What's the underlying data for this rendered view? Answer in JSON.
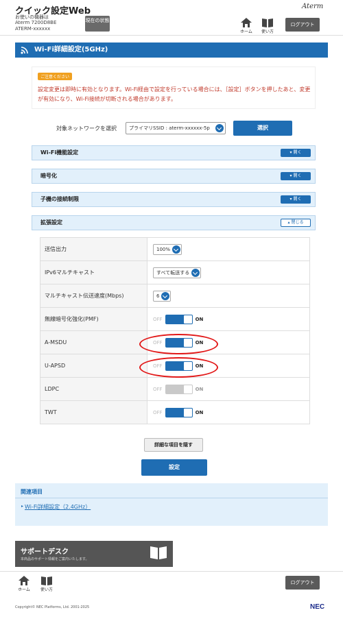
{
  "header": {
    "app_title": "クイック設定Web",
    "device_label": "お使いの機器は",
    "device_model": "Aterm 7200D8BE",
    "device_ssid": "ATERM-xxxxxx",
    "status_button": "現在の状態",
    "home_label": "ホーム",
    "help_label": "使い方",
    "logout_label": "ログアウト",
    "brand": "Aterm"
  },
  "page": {
    "title": "Wi-Fi詳細設定(5GHz)"
  },
  "caution": {
    "badge": "ご注意ください",
    "text": "設定変更は即時に有効となります。Wi-Fi経由で設定を行っている場合には、［設定］ボタンを押したあと、変更が有効になり、Wi-Fi接続が切断される場合があります。"
  },
  "network_select": {
    "label": "対象ネットワークを選択",
    "value": "プライマリSSID : aterm-xxxxxx-5p",
    "button": "選択"
  },
  "sections": [
    {
      "title": "Wi-Fi機能設定",
      "button": "開く"
    },
    {
      "title": "暗号化",
      "button": "開く"
    },
    {
      "title": "子機の接続制限",
      "button": "開く"
    },
    {
      "title": "拡張設定",
      "button": "閉じる"
    }
  ],
  "settings": [
    {
      "label": "送信出力",
      "type": "dropdown",
      "value": "100%"
    },
    {
      "label": "IPv6マルチキャスト",
      "type": "dropdown",
      "value": "すべて転送する"
    },
    {
      "label": "マルチキャスト伝送速度(Mbps)",
      "type": "dropdown",
      "value": "6"
    },
    {
      "label": "無線暗号化強化(PMF)",
      "type": "toggle",
      "off": "OFF",
      "on": "ON",
      "state": "on"
    },
    {
      "label": "A-MSDU",
      "type": "toggle",
      "off": "OFF",
      "on": "ON",
      "state": "on"
    },
    {
      "label": "U-APSD",
      "type": "toggle",
      "off": "OFF",
      "on": "ON",
      "state": "on"
    },
    {
      "label": "LDPC",
      "type": "toggle",
      "off": "OFF",
      "on": "ON",
      "state": "disabled"
    },
    {
      "label": "TWT",
      "type": "toggle",
      "off": "OFF",
      "on": "ON",
      "state": "on"
    }
  ],
  "buttons": {
    "hide_details": "詳細な項目を隠す",
    "save": "設定"
  },
  "related": {
    "title": "関連項目",
    "link": "Wi-Fi詳細設定（2.4GHz）"
  },
  "support": {
    "title": "サポートデスク",
    "subtitle": "本商品のサポート情報をご案内いたします。"
  },
  "footer": {
    "home_label": "ホーム",
    "help_label": "使い方",
    "logout_label": "ログアウト",
    "copyright": "Copyright© NEC Platforms, Ltd. 2001-2025",
    "logo": "NEC"
  },
  "colors": {
    "accent": "#1f6db3",
    "caution": "#f0a020",
    "highlight_ring": "#e21818"
  }
}
